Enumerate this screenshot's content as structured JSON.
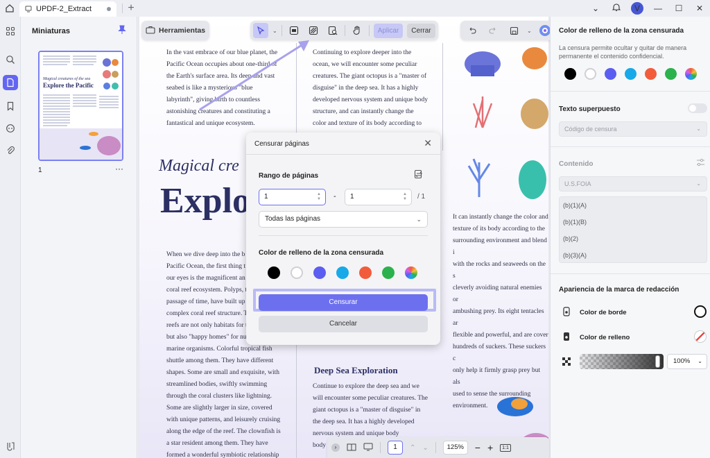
{
  "window": {
    "tab_title": "UPDF-2_Extract",
    "plus": "+",
    "user_initial": "V"
  },
  "thumbnails": {
    "title": "Miniaturas",
    "page_number": "1",
    "more": "···",
    "thumb_title": "Explore the Pacific",
    "thumb_subtitle": "Magical creatures of the sea"
  },
  "toolbar": {
    "tools_label": "Herramientas",
    "apply_label": "Aplicar",
    "close_label": "Cerrar"
  },
  "document": {
    "col1_top": [
      "In the vast embrace of our blue planet, the",
      "Pacific Ocean occupies about one-third of",
      "the Earth's surface area. Its deep and vast",
      "seabed is like a mysterious \"blue",
      "labyrinth\", giving birth to countless",
      "astonishing creatures and constituting a",
      "fantastical and unique ecosystem."
    ],
    "col2_top": [
      "Continuing to explore deeper into the",
      "ocean, we will encounter some peculiar",
      "creatures. The giant octopus is a \"master of",
      "disguise\" in the deep sea. It has a highly",
      "developed nervous system and unique body",
      "structure, and can instantly change the",
      "color and texture of its body according to"
    ],
    "italic_heading": "Magical cre",
    "big_heading": "Explo",
    "col1_bottom": [
      "When we dive deep into the b",
      "Pacific Ocean, the first thing t",
      "our eyes is the magnificent an",
      "coral reef ecosystem. Polyps, t",
      "passage of time, have built up",
      "complex coral reef structure. T",
      "reefs are not only habitats for t",
      "but also \"happy homes\" for nu",
      "marine organisms. Colorful tropical fish",
      "shuttle among them. They have different",
      "shapes. Some are small and exquisite, with",
      "streamlined bodies, swiftly swimming",
      "through the coral clusters like lightning.",
      "Some are slightly larger in size, covered",
      "with unique patterns, and leisurely cruising",
      "along the edge of the reef. The clownfish is",
      "a star resident among them. They have",
      "formed a wonderful symbiotic relationship"
    ],
    "col3_mid": [
      "It can instantly change the color and",
      "texture of its body according to the",
      "surrounding environment and blend i",
      "with the rocks and seaweeds on the s",
      "cleverly avoiding natural enemies or",
      "ambushing prey. Its eight tentacles ar",
      "flexible and powerful, and are cover",
      "hundreds of suckers. These suckers c",
      "only help it firmly grasp prey but als",
      "used to sense the surrounding",
      "environment."
    ],
    "deep_heading": "Deep Sea Exploration",
    "col2_bottom": [
      "Continue to explore the deep sea and we",
      "will encounter some peculiar creatures. The",
      "giant octopus is a \"master of disguise\" in",
      "the deep sea. It has a highly developed",
      "nervous system and unique body",
      "body"
    ]
  },
  "bottom_bar": {
    "page": "1",
    "zoom": "125%"
  },
  "dialog": {
    "title": "Censurar páginas",
    "range_label": "Rango de páginas",
    "from_value": "1",
    "separator": "-",
    "to_value": "1",
    "total": "/ 1",
    "pages_option": "Todas las páginas",
    "fill_label": "Color de relleno de la zona censurada",
    "censor_button": "Censurar",
    "cancel_button": "Cancelar",
    "swatch_colors": [
      "#000000",
      "#ffffff",
      "#5b5ef0",
      "#18a9e8",
      "#f25c3b",
      "#2bb24c"
    ]
  },
  "right_panel": {
    "fill_title": "Color de relleno de la zona censurada",
    "fill_desc": "La censura permite ocultar y quitar de manera permanente el contenido confidencial.",
    "swatch_colors": [
      "#000000",
      "#ffffff",
      "#5b5ef0",
      "#18a9e8",
      "#f25c3b",
      "#2bb24c"
    ],
    "overlay_title": "Texto superpuesto",
    "code_placeholder": "Código de censura",
    "content_label": "Contenido",
    "foia_value": "U.S.FOIA",
    "codes": [
      "(b)(1)(A)",
      "(b)(1)(B)",
      "(b)(2)",
      "(b)(3)(A)"
    ],
    "appearance_title": "Apariencia de la marca de redacción",
    "border_color_label": "Color de borde",
    "fill_color_label": "Color de relleno",
    "opacity_value": "100%"
  }
}
